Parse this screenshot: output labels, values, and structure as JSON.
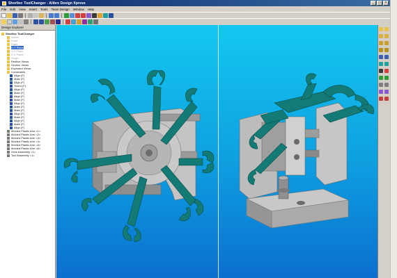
{
  "window": {
    "title": "ShorItec ToolChanger - Alibre Design Xpress",
    "controls": [
      "_",
      "□",
      "×"
    ]
  },
  "menu": [
    "File",
    "Edit",
    "View",
    "Insert",
    "Tools",
    "Team Design",
    "Window",
    "Help"
  ],
  "explorer": {
    "header": "Design Explorer",
    "items": [
      {
        "label": "ShorItec ToolChanger",
        "style": "bold"
      },
      {
        "label": "Home",
        "style": "faded"
      },
      {
        "label": "Front",
        "style": "faded"
      },
      {
        "label": "Right",
        "style": "faded"
      },
      {
        "label": "X-Y Plane",
        "style": "sel"
      },
      {
        "label": "Y-Z Plane",
        "style": "faded"
      },
      {
        "label": "Z-X Plane",
        "style": "faded"
      },
      {
        "label": "Origin",
        "style": "faded"
      },
      {
        "label": "Redline Views",
        "style": "normal"
      },
      {
        "label": "Section Views",
        "style": "normal"
      },
      {
        "label": "Exploded Views",
        "style": "normal"
      },
      {
        "label": "Constraints",
        "style": "normal"
      },
      {
        "label": "Align (F)",
        "style": "normal"
      },
      {
        "label": "Mate (F)",
        "style": "normal"
      },
      {
        "label": "Align (F)",
        "style": "normal"
      },
      {
        "label": "Orient (F)",
        "style": "normal"
      },
      {
        "label": "Align (F)",
        "style": "normal"
      },
      {
        "label": "Mate (F)",
        "style": "normal"
      },
      {
        "label": "Align (F)",
        "style": "normal"
      },
      {
        "label": "Mate (F)",
        "style": "normal"
      },
      {
        "label": "Align (F)",
        "style": "normal"
      },
      {
        "label": "Mate (F)",
        "style": "normal"
      },
      {
        "label": "Mate (F)",
        "style": "normal"
      },
      {
        "label": "Align (F)",
        "style": "normal"
      },
      {
        "label": "Mate (F)",
        "style": "normal"
      },
      {
        "label": "Align (F)",
        "style": "normal"
      },
      {
        "label": "Mate (F)",
        "style": "normal"
      },
      {
        "label": "Align (F)",
        "style": "normal"
      },
      {
        "label": "Molded Plastic Arm <1>",
        "style": "normal"
      },
      {
        "label": "Molded Plastic Arm <2>",
        "style": "normal"
      },
      {
        "label": "Molded Plastic Arm <3>",
        "style": "normal"
      },
      {
        "label": "Molded Plastic Arm <4>",
        "style": "normal"
      },
      {
        "label": "Molded Plastic Arm <5>",
        "style": "normal"
      },
      {
        "label": "Molded Plastic Arm <6>",
        "style": "normal"
      },
      {
        "label": "Gear Assembly <1>",
        "style": "normal"
      },
      {
        "label": "Tool Assembly <1>",
        "style": "normal"
      }
    ]
  },
  "colors": {
    "title_bar": "#0a246a",
    "viewport_top": "#14c8f0",
    "viewport_bottom": "#0b6fcf",
    "part_teal": "#137a75",
    "part_grey": "#a8a8a8"
  }
}
